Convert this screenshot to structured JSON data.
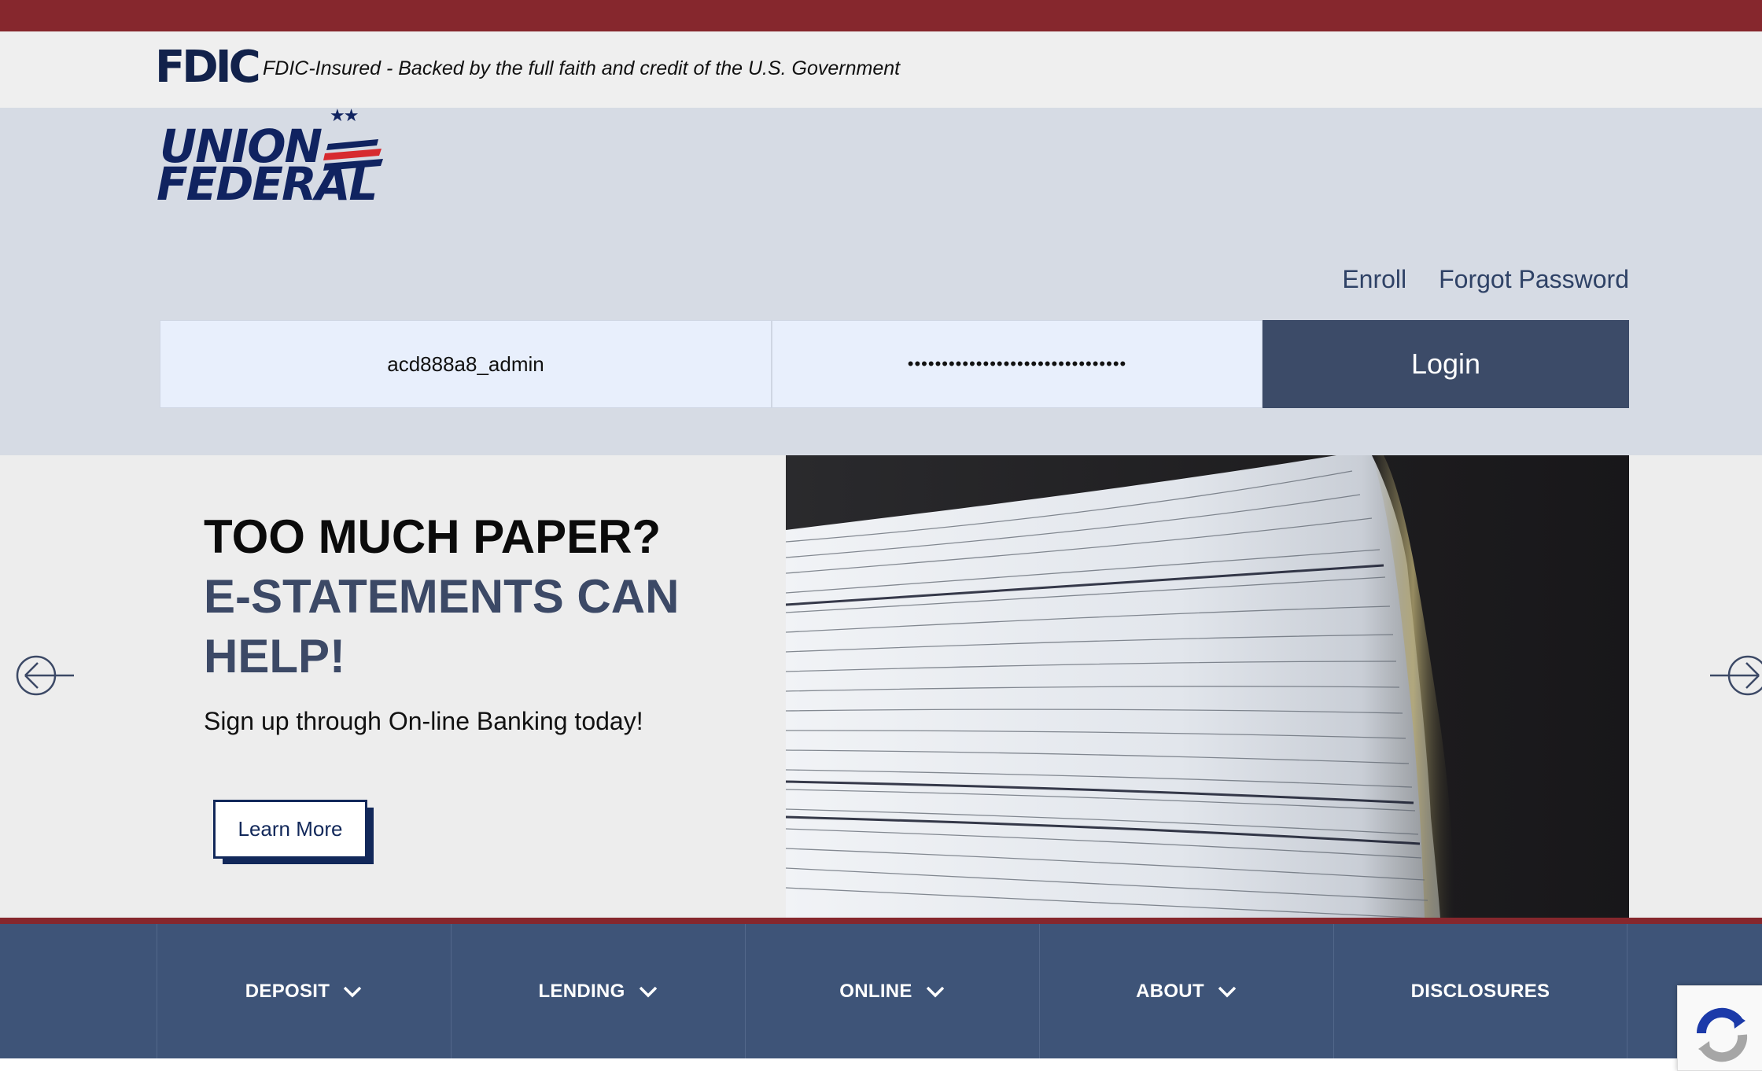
{
  "fdic": {
    "logo_text": "FDIC",
    "statement": "FDIC-Insured - Backed by the full faith and credit of the U.S. Government"
  },
  "brand": {
    "line1": "UNION",
    "line2": "FEDERAL",
    "stars": "★★"
  },
  "auth": {
    "enroll": "Enroll",
    "forgot_password": "Forgot Password"
  },
  "login": {
    "username_value": "acd888a8_admin",
    "password_value": "••••••••••••••••••••••••••••••••",
    "button": "Login"
  },
  "hero": {
    "title_line1": "TOO MUCH PAPER?",
    "title_line2": "E-STATEMENTS CAN HELP!",
    "subtitle": "Sign up through On-line Banking today!",
    "cta": "Learn More"
  },
  "nav": {
    "items": [
      {
        "label": "DEPOSIT",
        "has_dropdown": true
      },
      {
        "label": "LENDING",
        "has_dropdown": true
      },
      {
        "label": "ONLINE",
        "has_dropdown": true
      },
      {
        "label": "ABOUT",
        "has_dropdown": true
      },
      {
        "label": "DISCLOSURES",
        "has_dropdown": false
      }
    ]
  },
  "colors": {
    "accent_red": "#86272d",
    "navy": "#3c4b68",
    "nav_blue": "#3e5478",
    "brand_navy": "#102360"
  },
  "icons": {
    "carousel_prev": "arrow-left-circle-icon",
    "carousel_next": "arrow-right-circle-icon",
    "dropdown": "chevron-down-icon",
    "recaptcha": "recaptcha-icon"
  }
}
